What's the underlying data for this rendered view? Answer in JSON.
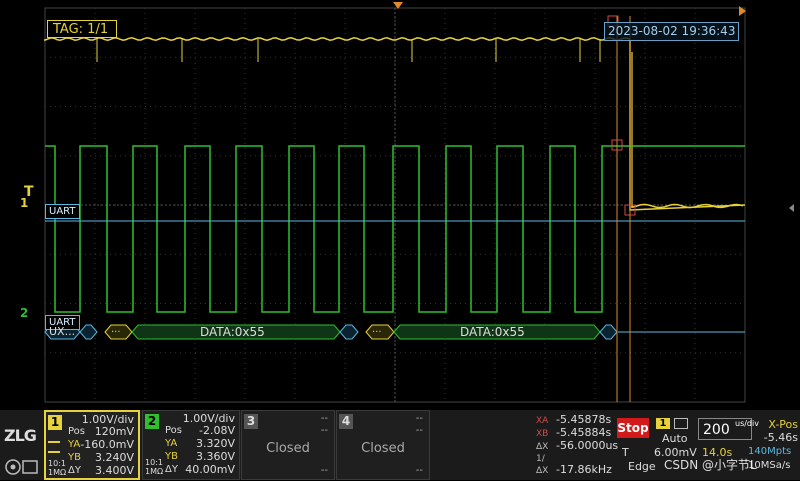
{
  "screen": {
    "tag": "TAG: 1/1",
    "datetime": "2023-08-02 19:36:43",
    "ch1_marker": "1",
    "ch2_marker": "2",
    "trigger_marker": "T",
    "uart_label_1": "UART",
    "uart_label_2": "UART",
    "decode": {
      "first_fragment": "UX...",
      "ellipsis": "...",
      "frame1": "DATA:0x55",
      "frame2": "DATA:0x55"
    }
  },
  "colors": {
    "ch1": "#e6d23a",
    "ch2": "#2fbf2f",
    "uart": "#5bb8e0",
    "cursor": "#e08a2a",
    "stop": "#d21a1a"
  },
  "panel": {
    "logo": "ZLG",
    "ch1": {
      "number": "1",
      "scale": "1.00V/div",
      "pos_label": "Pos",
      "pos": "120mV",
      "ya_label": "YA",
      "ya": "-160.0mV",
      "yb_label": "YB",
      "yb": "3.240V",
      "dy_label": "ΔY",
      "dy": "3.400V",
      "coupling": "10:1",
      "impedance": "1MΩ"
    },
    "ch2": {
      "number": "2",
      "scale": "1.00V/div",
      "pos_label": "Pos",
      "pos": "-2.08V",
      "ya_label": "YA",
      "ya": "3.320V",
      "yb_label": "YB",
      "yb": "3.360V",
      "dy_label": "ΔY",
      "dy": "40.00mV",
      "coupling": "10:1",
      "impedance": "1MΩ"
    },
    "ch3": {
      "number": "3",
      "status": "Closed",
      "dash": "--"
    },
    "ch4": {
      "number": "4",
      "status": "Closed",
      "dash": "--"
    },
    "cursor": {
      "xa_label": "XA",
      "xa": "-5.45878s",
      "xb_label": "XB",
      "xb": "-5.45884s",
      "dx_label": "ΔX",
      "dx": "-56.0000us",
      "inv_dx_label": "1/ΔX",
      "inv_dx": "-17.86kHz"
    },
    "run": {
      "stop": "Stop",
      "trigger_source": "1",
      "mode": "Auto",
      "trig_label": "T",
      "trig_level": "6.00mV",
      "trig_type": "Edge"
    },
    "timebase": {
      "value": "200",
      "unit": "us/div",
      "xpos_label": "X-Pos",
      "xpos": "-5.46s",
      "record": "14.0s",
      "rate": "140Mpts",
      "sample": "10MSa/s"
    },
    "watermark": "CSDN @小字节L"
  }
}
